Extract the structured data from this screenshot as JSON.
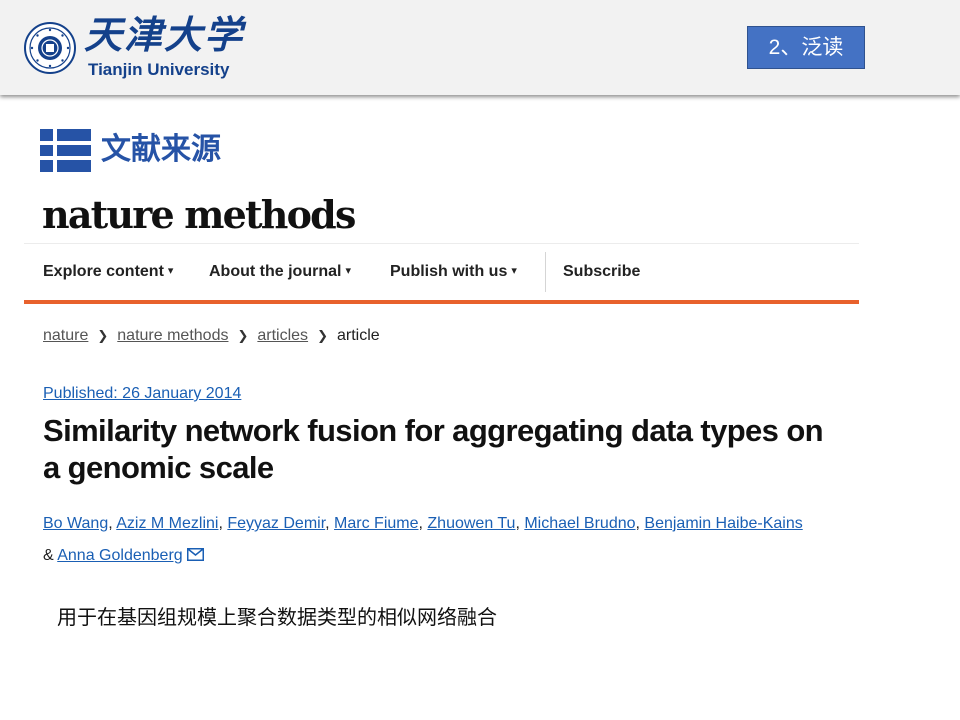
{
  "banner": {
    "logo_cn": "天津大学",
    "logo_en": "Tianjin University",
    "seal_name": "tianjin-university-seal",
    "tag": "2、泛读"
  },
  "section": {
    "title": "文献来源"
  },
  "journal": {
    "name": "nature methods"
  },
  "nav": {
    "items": [
      {
        "label": "Explore content",
        "chevron": "▾"
      },
      {
        "label": "About the journal",
        "chevron": "▾"
      },
      {
        "label": "Publish with us",
        "chevron": "▾"
      },
      {
        "label": "Subscribe"
      }
    ],
    "accent": "#e8612c"
  },
  "breadcrumb": [
    "nature",
    "nature methods",
    "articles",
    "article"
  ],
  "article": {
    "published": "Published: 26 January 2014",
    "title": "Similarity network fusion for aggregating data types on a genomic scale",
    "authors": [
      "Bo Wang",
      "Aziz M Mezlini",
      "Feyyaz Demir",
      "Marc Fiume",
      "Zhuowen Tu",
      "Michael Brudno",
      "Benjamin Haibe-Kains"
    ],
    "last_author": "Anna Goldenberg",
    "amp": "&"
  },
  "caption": "用于在基因组规模上聚合数据类型的相似网络融合",
  "colors": {
    "brand_blue": "#14418b",
    "tag_blue": "#4472c4",
    "link_blue": "#1a5fb4"
  }
}
